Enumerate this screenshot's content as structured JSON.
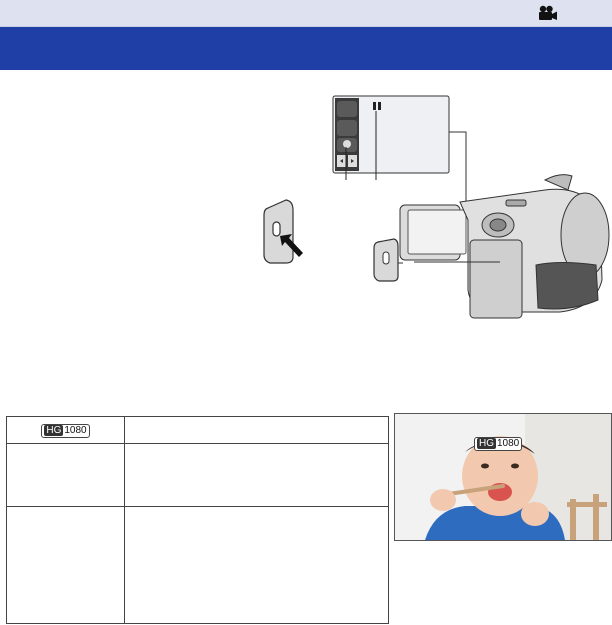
{
  "header": {
    "mode_icon": "movie-camera-icon",
    "title": ""
  },
  "illustration": {
    "lcd_screen": "lcd-screen-icons",
    "camera": "camcorder-side-view",
    "button": "power-button"
  },
  "table": {
    "rows": [
      {
        "badge_prefix": "HG",
        "badge_suffix": "1080",
        "description": ""
      },
      {
        "label": "",
        "description": ""
      },
      {
        "label": "",
        "description": ""
      }
    ]
  },
  "photo": {
    "osd_prefix": "HG",
    "osd_suffix": "1080",
    "subject": "baby-eating-photo"
  },
  "colors": {
    "header_band": "#dde1f0",
    "title_band": "#1f3ea6"
  }
}
